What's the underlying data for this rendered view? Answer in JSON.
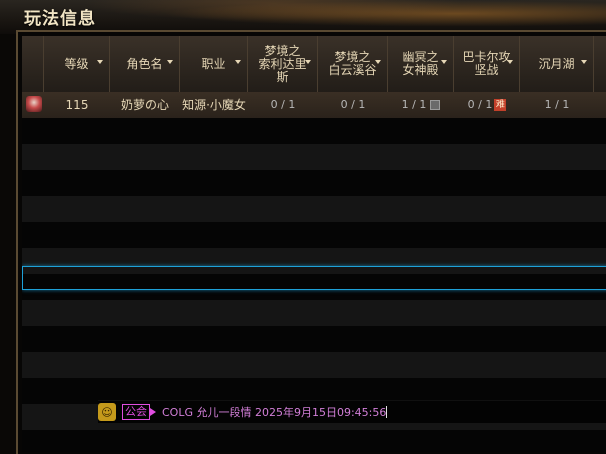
{
  "window": {
    "title": "玩法信息"
  },
  "colors": {
    "accent": "#1ea1d8",
    "guild": "#e04ee0",
    "header_text": "#e6d7b6"
  },
  "table": {
    "columns": [
      {
        "label": ""
      },
      {
        "label": "等级"
      },
      {
        "label": "角色名"
      },
      {
        "label": "职业"
      },
      {
        "label": "梦境之\n索利达里\n斯"
      },
      {
        "label": "梦境之\n白云溪谷"
      },
      {
        "label": "幽冥之\n女神殿"
      },
      {
        "label": "巴卡尔攻\n坚战"
      },
      {
        "label": "沉月湖"
      }
    ],
    "rows": [
      {
        "icon": "class-icon",
        "level": "115",
        "name": "奶萝の心",
        "class": "知源·小魔女",
        "c1": "0 / 1",
        "c2": "0 / 1",
        "c3": "1 / 1",
        "c3_icon": "lock-icon",
        "c4": "0 / 1",
        "c4_badge": "难",
        "c5": "1 / 1"
      }
    ]
  },
  "chat": {
    "icon": "smiley-icon",
    "icon_glyph": "☺",
    "guild_tag": "公会",
    "line": "COLG    允儿一段情    2025年9月15日09:45:56"
  }
}
